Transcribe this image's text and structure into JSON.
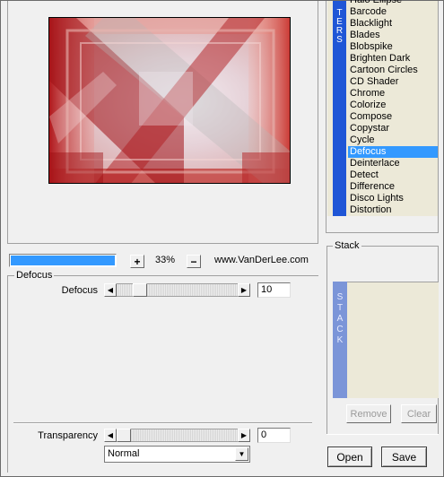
{
  "filters": {
    "tab_label": [
      "T",
      "E",
      "R",
      "S"
    ],
    "items": [
      "Halo Ellipse",
      "Barcode",
      "Blacklight",
      "Blades",
      "Blobspike",
      "Brighten Dark",
      "Cartoon Circles",
      "CD Shader",
      "Chrome",
      "Colorize",
      "Compose",
      "Copystar",
      "Cycle",
      "Defocus",
      "Deinterlace",
      "Detect",
      "Difference",
      "Disco Lights",
      "Distortion"
    ],
    "selected": "Defocus"
  },
  "toolbar": {
    "progress": 1.0,
    "zoom_in": "+",
    "zoom": "33%",
    "zoom_out": "−",
    "site": "www.VanDerLee.com"
  },
  "params": {
    "group_title": "Defocus",
    "defocus_label": "Defocus",
    "defocus_value": "10",
    "defocus_fraction": 0.15
  },
  "transparency": {
    "label": "Transparency",
    "value": "0",
    "fraction": 0.0,
    "blend_mode": "Normal"
  },
  "stack": {
    "title": "Stack",
    "tab_label": [
      "S",
      "T",
      "A",
      "C",
      "K"
    ],
    "remove": "Remove",
    "clear": "Clear"
  },
  "buttons": {
    "open": "Open",
    "save": "Save"
  },
  "colors": {
    "accent": "#3399ff",
    "filter_tab": "#1f56d6",
    "stack_tab": "#7b95d8",
    "panel_bg": "#ece9d8"
  }
}
